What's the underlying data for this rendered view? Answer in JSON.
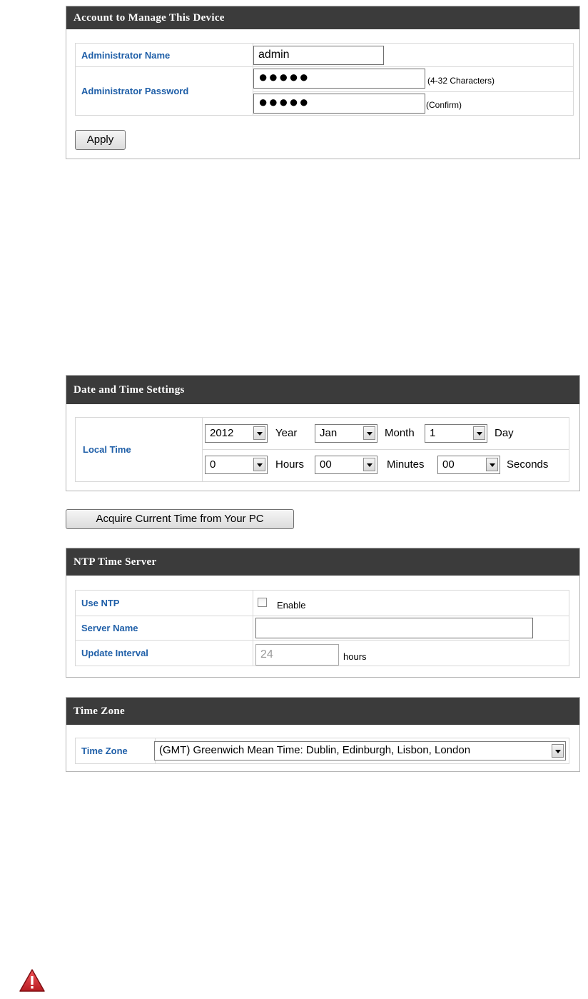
{
  "account": {
    "header": "Account to Manage This Device",
    "admin_name_label": "Administrator Name",
    "admin_name_value": "admin",
    "admin_password_label": "Administrator Password",
    "password_value": "●●●●●",
    "confirm_value": "●●●●●",
    "password_hint": "(4-32 Characters)",
    "confirm_hint": "(Confirm)",
    "apply_label": "Apply"
  },
  "datetime": {
    "header": "Date and Time Settings",
    "local_time_label": "Local Time",
    "year_value": "2012",
    "year_label": "Year",
    "month_value": "Jan",
    "month_label": "Month",
    "day_value": "1",
    "day_label": "Day",
    "hours_value": "0",
    "hours_label": "Hours",
    "minutes_value": "00",
    "minutes_label": "Minutes",
    "seconds_value": "00",
    "seconds_label": "Seconds",
    "acquire_label": "Acquire Current Time from Your PC"
  },
  "ntp": {
    "header": "NTP Time Server",
    "use_ntp_label": "Use NTP",
    "enable_label": "Enable",
    "enabled": false,
    "server_name_label": "Server Name",
    "server_name_value": "",
    "update_interval_label": "Update Interval",
    "update_interval_value": "24",
    "update_interval_unit": "hours"
  },
  "timezone": {
    "header": "Time Zone",
    "label": "Time Zone",
    "value": "(GMT) Greenwich Mean Time: Dublin, Edinburgh, Lisbon, London"
  },
  "icons": {
    "warning": "warning-triangle-icon"
  },
  "colors": {
    "header_bg": "#3b3b3b",
    "label_blue": "#1f5fa8",
    "warning_red": "#d8262b"
  }
}
